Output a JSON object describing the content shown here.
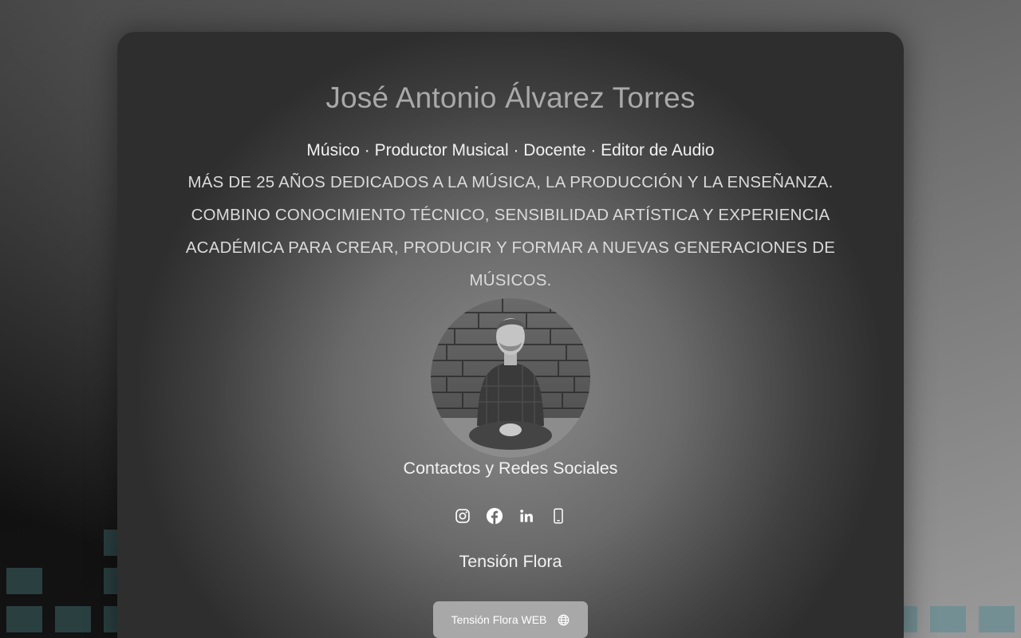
{
  "profile": {
    "name": "José Antonio Álvarez Torres",
    "roles": "Músico · Productor Musical · Docente · Editor de Audio",
    "bio": "Más de 25 años dedicados a la música, la producción y la enseñanza. Combino conocimiento técnico, sensibilidad artística y experiencia académica para crear, producir y formar a nuevas generaciones de músicos."
  },
  "contacts": {
    "heading": "Contactos y Redes Sociales",
    "links": [
      {
        "icon": "instagram-icon"
      },
      {
        "icon": "facebook-icon"
      },
      {
        "icon": "linkedin-icon"
      },
      {
        "icon": "phone-icon"
      }
    ]
  },
  "band": {
    "name": "Tensión Flora",
    "web_button_label": "Tensión Flora WEB",
    "web_button_icon": "globe-icon"
  },
  "colors": {
    "eq_left": "#2e4546",
    "eq_right": "#6f8e93",
    "button_bg": "#a8a8a8"
  }
}
